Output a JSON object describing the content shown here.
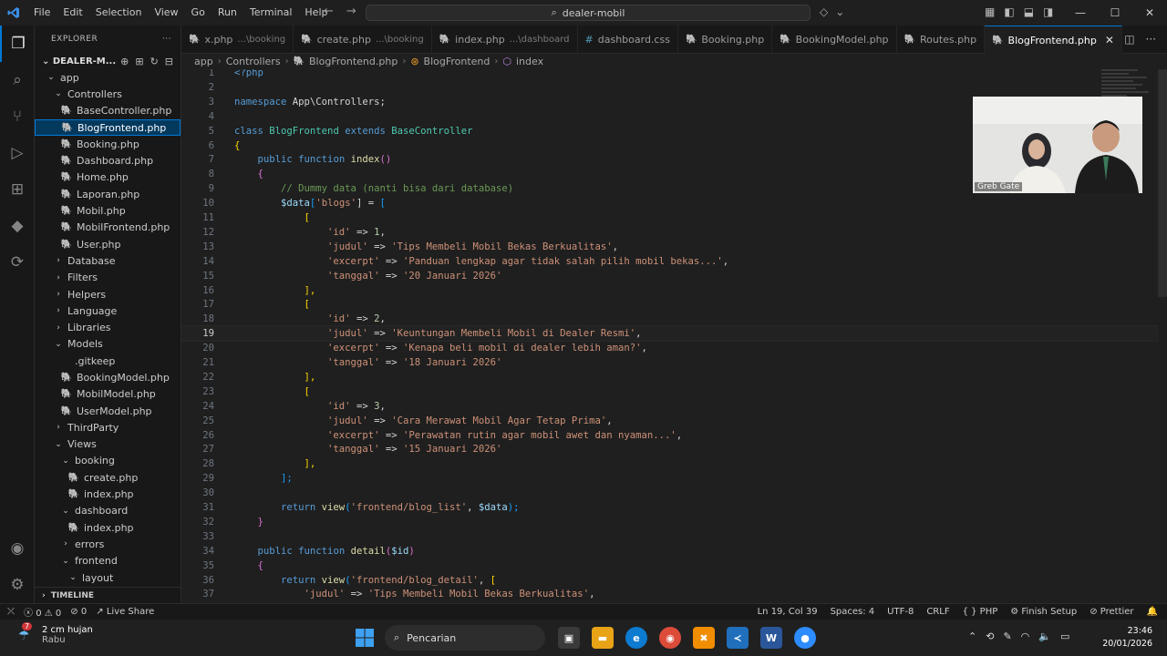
{
  "titlebar": {
    "menu": [
      "File",
      "Edit",
      "Selection",
      "View",
      "Go",
      "Run",
      "Terminal",
      "Help"
    ],
    "search": "dealer-mobil"
  },
  "sidebar": {
    "header": "EXPLORER",
    "project": "DEALER-M...",
    "timeline": "TIMELINE"
  },
  "tree": [
    {
      "label": "app",
      "indent": 1,
      "type": "folder-open"
    },
    {
      "label": "Controllers",
      "indent": 2,
      "type": "folder-open"
    },
    {
      "label": "BaseController.php",
      "indent": 3,
      "type": "php"
    },
    {
      "label": "BlogFrontend.php",
      "indent": 3,
      "type": "php",
      "selected": true
    },
    {
      "label": "Booking.php",
      "indent": 3,
      "type": "php"
    },
    {
      "label": "Dashboard.php",
      "indent": 3,
      "type": "php"
    },
    {
      "label": "Home.php",
      "indent": 3,
      "type": "php"
    },
    {
      "label": "Laporan.php",
      "indent": 3,
      "type": "php"
    },
    {
      "label": "Mobil.php",
      "indent": 3,
      "type": "php"
    },
    {
      "label": "MobilFrontend.php",
      "indent": 3,
      "type": "php"
    },
    {
      "label": "User.php",
      "indent": 3,
      "type": "php"
    },
    {
      "label": "Database",
      "indent": 2,
      "type": "folder"
    },
    {
      "label": "Filters",
      "indent": 2,
      "type": "folder"
    },
    {
      "label": "Helpers",
      "indent": 2,
      "type": "folder"
    },
    {
      "label": "Language",
      "indent": 2,
      "type": "folder"
    },
    {
      "label": "Libraries",
      "indent": 2,
      "type": "folder"
    },
    {
      "label": "Models",
      "indent": 2,
      "type": "folder-open"
    },
    {
      "label": ".gitkeep",
      "indent": 3,
      "type": "file"
    },
    {
      "label": "BookingModel.php",
      "indent": 3,
      "type": "php"
    },
    {
      "label": "MobilModel.php",
      "indent": 3,
      "type": "php"
    },
    {
      "label": "UserModel.php",
      "indent": 3,
      "type": "php"
    },
    {
      "label": "ThirdParty",
      "indent": 2,
      "type": "folder"
    },
    {
      "label": "Views",
      "indent": 2,
      "type": "folder-open"
    },
    {
      "label": "booking",
      "indent": 3,
      "type": "folder-open"
    },
    {
      "label": "create.php",
      "indent": 4,
      "type": "php"
    },
    {
      "label": "index.php",
      "indent": 4,
      "type": "php"
    },
    {
      "label": "dashboard",
      "indent": 3,
      "type": "folder-open"
    },
    {
      "label": "index.php",
      "indent": 4,
      "type": "php"
    },
    {
      "label": "errors",
      "indent": 3,
      "type": "folder"
    },
    {
      "label": "frontend",
      "indent": 3,
      "type": "folder-open"
    },
    {
      "label": "layout",
      "indent": 4,
      "type": "folder-open"
    }
  ],
  "tabs": [
    {
      "label": "x.php",
      "dir": "...\\booking",
      "icon": "php"
    },
    {
      "label": "create.php",
      "dir": "...\\booking",
      "icon": "php"
    },
    {
      "label": "index.php",
      "dir": "...\\dashboard",
      "icon": "php"
    },
    {
      "label": "dashboard.css",
      "dir": "",
      "icon": "css"
    },
    {
      "label": "Booking.php",
      "dir": "",
      "icon": "php"
    },
    {
      "label": "BookingModel.php",
      "dir": "",
      "icon": "php"
    },
    {
      "label": "Routes.php",
      "dir": "",
      "icon": "php"
    },
    {
      "label": "BlogFrontend.php",
      "dir": "",
      "icon": "php",
      "active": true
    }
  ],
  "breadcrumb": [
    "app",
    "Controllers",
    "BlogFrontend.php",
    "BlogFrontend",
    "index"
  ],
  "code": {
    "current_line": 19,
    "lines": [
      [
        [
          "<?php",
          "kw"
        ]
      ],
      [],
      [
        [
          "namespace ",
          "kw"
        ],
        [
          "App\\Controllers",
          "ns"
        ],
        [
          ";",
          "ns"
        ]
      ],
      [],
      [
        [
          "class ",
          "kw"
        ],
        [
          "BlogFrontend ",
          "ty"
        ],
        [
          "extends ",
          "kw"
        ],
        [
          "BaseController",
          "ty"
        ]
      ],
      [
        [
          "{",
          "br1"
        ]
      ],
      [
        [
          "    public ",
          "kw"
        ],
        [
          "function ",
          "kw"
        ],
        [
          "index",
          "fn"
        ],
        [
          "()",
          "br2"
        ]
      ],
      [
        [
          "    {",
          "br2"
        ]
      ],
      [
        [
          "        // Dummy data (nanti bisa dari database)",
          "cm"
        ]
      ],
      [
        [
          "        $data",
          "var"
        ],
        [
          "[",
          "br3"
        ],
        [
          "'blogs'",
          "str"
        ],
        [
          "] = ",
          "ns"
        ],
        [
          "[",
          "br3"
        ]
      ],
      [
        [
          "            [",
          "br1"
        ]
      ],
      [
        [
          "                'id'",
          "str"
        ],
        [
          " => ",
          "ns"
        ],
        [
          "1",
          "num"
        ],
        [
          ",",
          "ns"
        ]
      ],
      [
        [
          "                'judul'",
          "str"
        ],
        [
          " => ",
          "ns"
        ],
        [
          "'Tips Membeli Mobil Bekas Berkualitas'",
          "str"
        ],
        [
          ",",
          "ns"
        ]
      ],
      [
        [
          "                'excerpt'",
          "str"
        ],
        [
          " => ",
          "ns"
        ],
        [
          "'Panduan lengkap agar tidak salah pilih mobil bekas...'",
          "str"
        ],
        [
          ",",
          "ns"
        ]
      ],
      [
        [
          "                'tanggal'",
          "str"
        ],
        [
          " => ",
          "ns"
        ],
        [
          "'20 Januari 2026'",
          "str"
        ]
      ],
      [
        [
          "            ],",
          "br1"
        ]
      ],
      [
        [
          "            [",
          "br1"
        ]
      ],
      [
        [
          "                'id'",
          "str"
        ],
        [
          " => ",
          "ns"
        ],
        [
          "2",
          "num"
        ],
        [
          ",",
          "ns"
        ]
      ],
      [
        [
          "                'judul'",
          "str"
        ],
        [
          " => ",
          "ns"
        ],
        [
          "'Keuntungan Membeli Mobil di Dealer Resmi'",
          "str"
        ],
        [
          ",",
          "ns"
        ]
      ],
      [
        [
          "                'excerpt'",
          "str"
        ],
        [
          " => ",
          "ns"
        ],
        [
          "'Kenapa beli mobil di dealer lebih aman?'",
          "str"
        ],
        [
          ",",
          "ns"
        ]
      ],
      [
        [
          "                'tanggal'",
          "str"
        ],
        [
          " => ",
          "ns"
        ],
        [
          "'18 Januari 2026'",
          "str"
        ]
      ],
      [
        [
          "            ],",
          "br1"
        ]
      ],
      [
        [
          "            [",
          "br1"
        ]
      ],
      [
        [
          "                'id'",
          "str"
        ],
        [
          " => ",
          "ns"
        ],
        [
          "3",
          "num"
        ],
        [
          ",",
          "ns"
        ]
      ],
      [
        [
          "                'judul'",
          "str"
        ],
        [
          " => ",
          "ns"
        ],
        [
          "'Cara Merawat Mobil Agar Tetap Prima'",
          "str"
        ],
        [
          ",",
          "ns"
        ]
      ],
      [
        [
          "                'excerpt'",
          "str"
        ],
        [
          " => ",
          "ns"
        ],
        [
          "'Perawatan rutin agar mobil awet dan nyaman...'",
          "str"
        ],
        [
          ",",
          "ns"
        ]
      ],
      [
        [
          "                'tanggal'",
          "str"
        ],
        [
          " => ",
          "ns"
        ],
        [
          "'15 Januari 2026'",
          "str"
        ]
      ],
      [
        [
          "            ],",
          "br1"
        ]
      ],
      [
        [
          "        ];",
          "br3"
        ]
      ],
      [],
      [
        [
          "        return ",
          "kw"
        ],
        [
          "view",
          "fn"
        ],
        [
          "(",
          "br3"
        ],
        [
          "'frontend/blog_list'",
          "str"
        ],
        [
          ", ",
          "ns"
        ],
        [
          "$data",
          "var"
        ],
        [
          ");",
          "br3"
        ]
      ],
      [
        [
          "    }",
          "br2"
        ]
      ],
      [],
      [
        [
          "    public ",
          "kw"
        ],
        [
          "function ",
          "kw"
        ],
        [
          "detail",
          "fn"
        ],
        [
          "(",
          "br2"
        ],
        [
          "$id",
          "var"
        ],
        [
          ")",
          "br2"
        ]
      ],
      [
        [
          "    {",
          "br2"
        ]
      ],
      [
        [
          "        return ",
          "kw"
        ],
        [
          "view",
          "fn"
        ],
        [
          "(",
          "br3"
        ],
        [
          "'frontend/blog_detail'",
          "str"
        ],
        [
          ", ",
          "ns"
        ],
        [
          "[",
          "br1"
        ]
      ],
      [
        [
          "            'judul'",
          "str"
        ],
        [
          " => ",
          "ns"
        ],
        [
          "'Tips Membeli Mobil Bekas Berkualitas'",
          "str"
        ],
        [
          ",",
          "ns"
        ]
      ]
    ]
  },
  "video": {
    "label": "Greb Gate"
  },
  "statusbar": {
    "errors": "0",
    "warnings": "0",
    "ports": "0",
    "live_share": "Live Share",
    "position": "Ln 19, Col 39",
    "spaces": "Spaces: 4",
    "encoding": "UTF-8",
    "eol": "CRLF",
    "language": "PHP",
    "finish_setup": "Finish Setup",
    "prettier": "Prettier"
  },
  "taskbar": {
    "weather_temp": "2 cm hujan",
    "weather_day": "Rabu",
    "weather_badge": "7",
    "search": "Pencarian",
    "time": "23:46",
    "date": "20/01/2026"
  },
  "colors": {
    "accent": "#0078d4",
    "php_icon": "#a074c4"
  }
}
